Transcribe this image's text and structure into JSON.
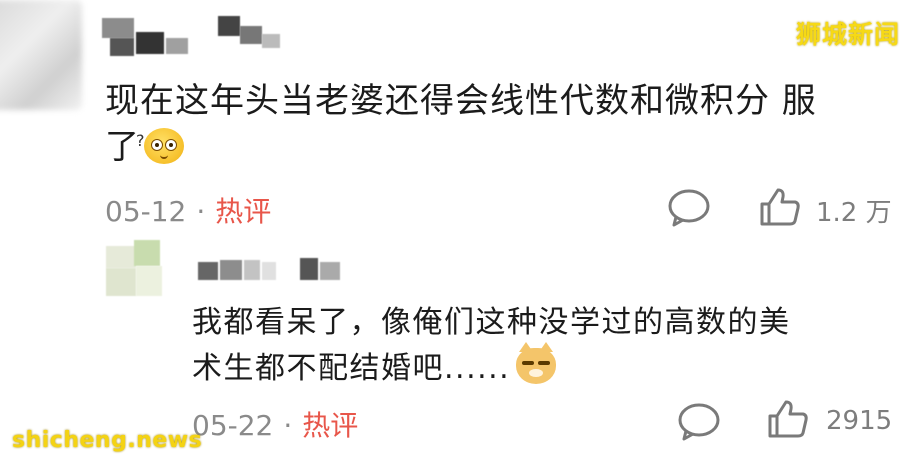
{
  "watermarks": {
    "top": "狮城新闻",
    "bottom": "shicheng.news"
  },
  "comment": {
    "text_line1": "现在这年头当老婆还得会线性代数和微积分 服",
    "text_line2": "了",
    "date": "05-12",
    "separator": "·",
    "hot_label": "热评",
    "like_count": "1.2 万"
  },
  "reply": {
    "text_line1": "我都看呆了，像俺们这种没学过的高数的美",
    "text_line2": "术生都不配结婚吧......",
    "date": "05-22",
    "separator": "·",
    "hot_label": "热评",
    "like_count": "2915"
  },
  "icons": {
    "comment": "comment-bubble-icon",
    "like": "thumbs-up-icon",
    "emoji1": "thinking-face-emoji",
    "emoji2": "smug-cat-emoji"
  },
  "colors": {
    "hot": "#e8564a",
    "meta": "#8a8a8a",
    "watermark": "#f6d916"
  }
}
